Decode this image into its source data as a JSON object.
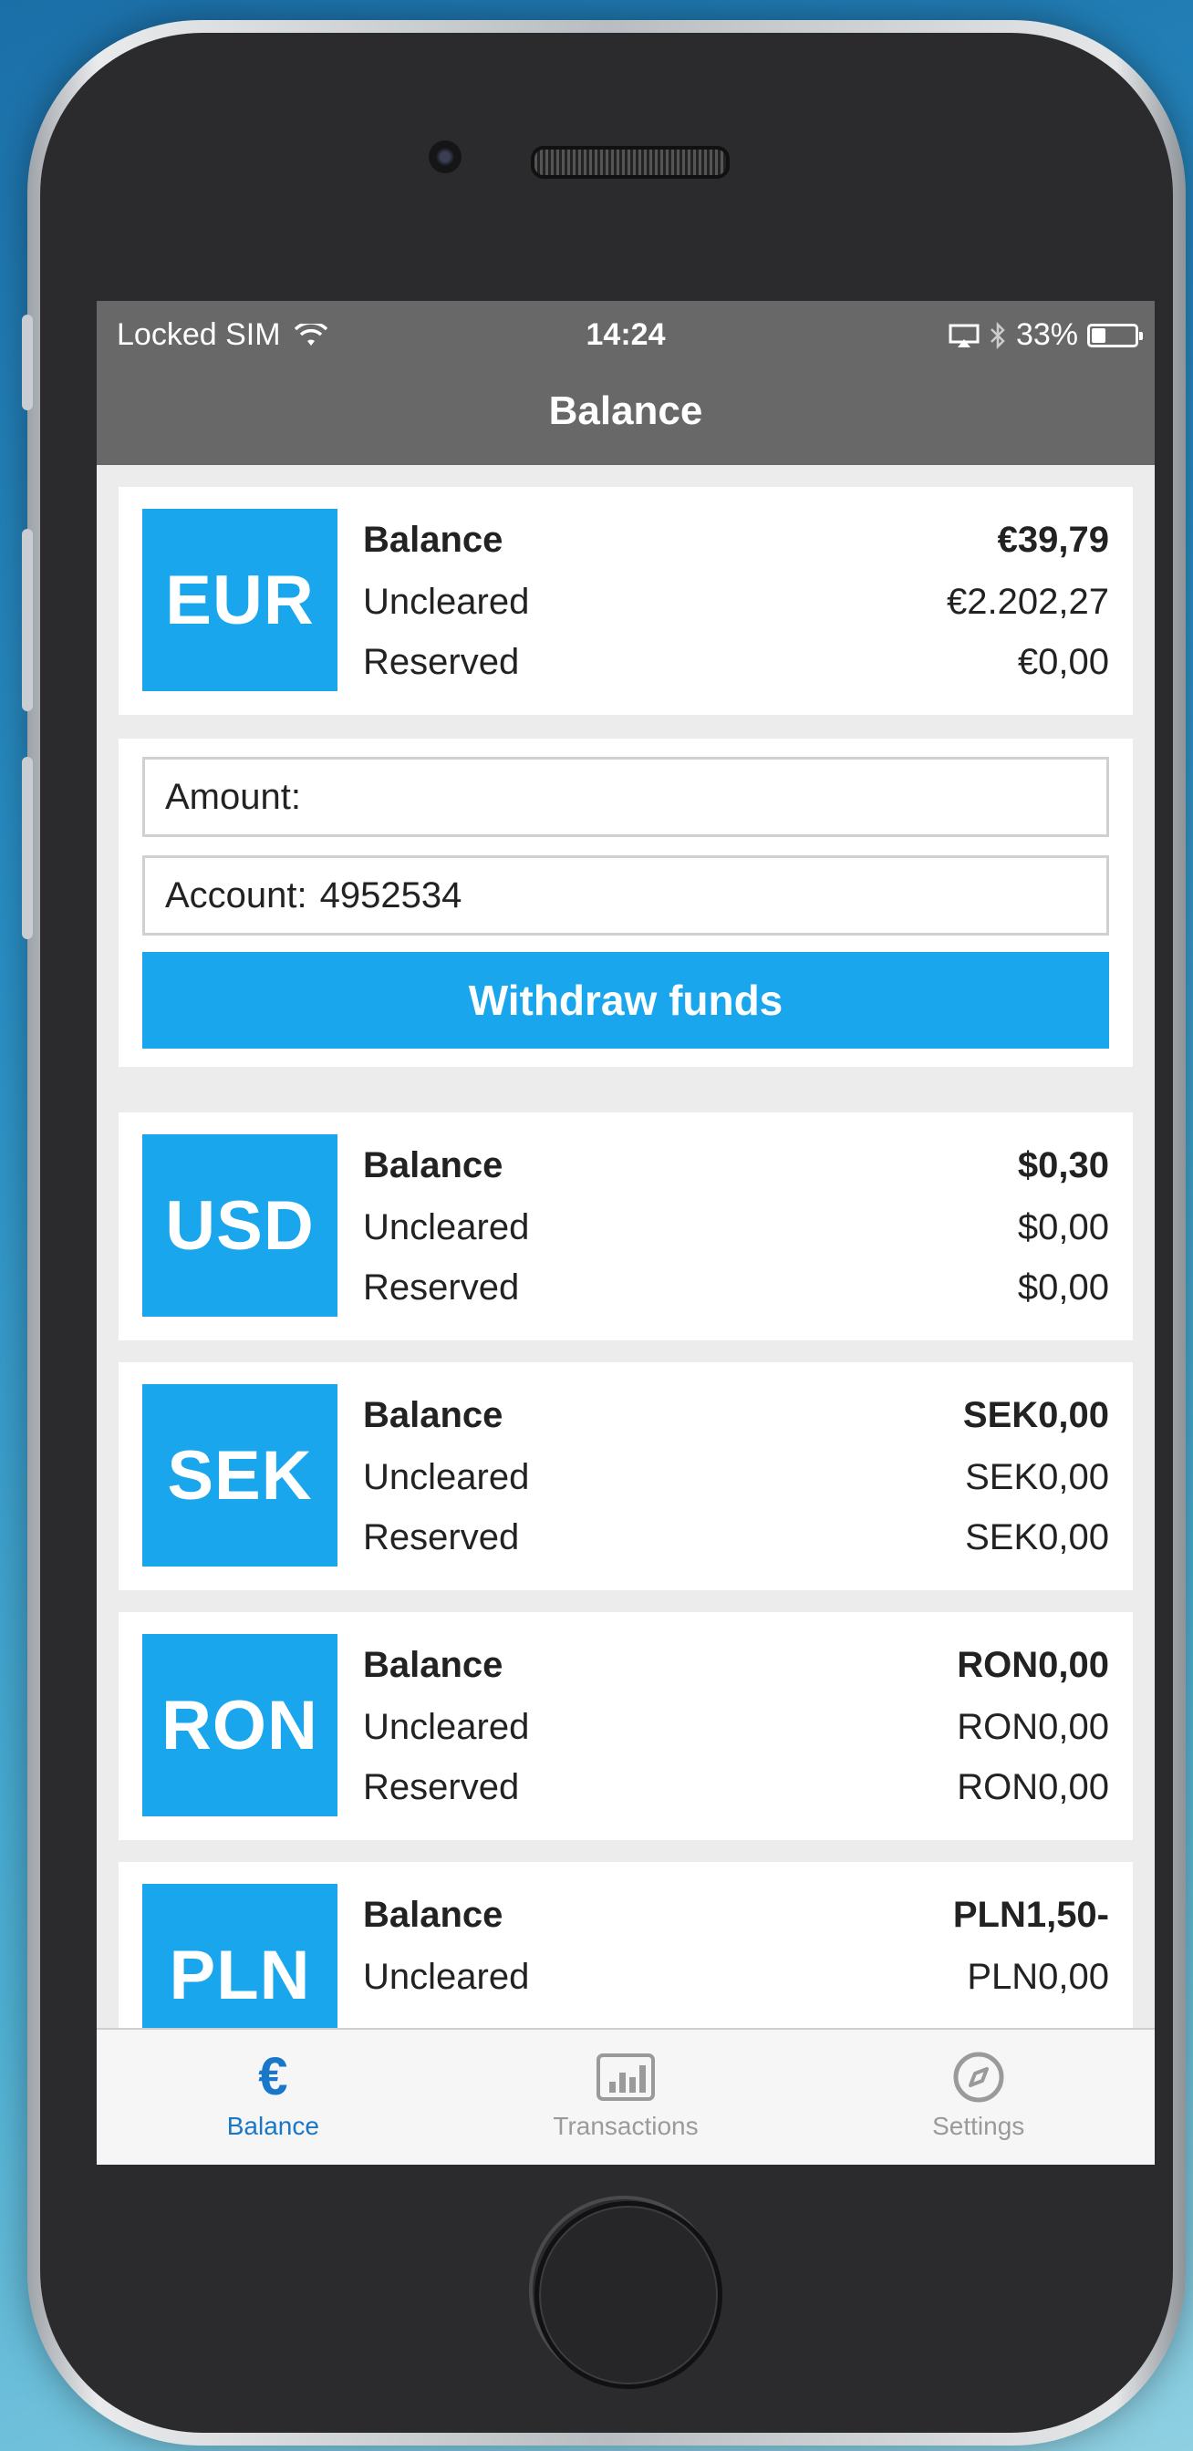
{
  "status_bar": {
    "carrier": "Locked SIM",
    "time": "14:24",
    "battery": "33%",
    "battery_level": 0.33
  },
  "nav": {
    "title": "Balance"
  },
  "accounts": [
    {
      "code": "EUR",
      "balance_label": "Balance",
      "balance": "€39,79",
      "uncleared_label": "Uncleared",
      "uncleared": "€2.202,27",
      "reserved_label": "Reserved",
      "reserved": "€0,00"
    },
    {
      "code": "USD",
      "balance_label": "Balance",
      "balance": "$0,30",
      "uncleared_label": "Uncleared",
      "uncleared": "$0,00",
      "reserved_label": "Reserved",
      "reserved": "$0,00"
    },
    {
      "code": "SEK",
      "balance_label": "Balance",
      "balance": "SEK0,00",
      "uncleared_label": "Uncleared",
      "uncleared": "SEK0,00",
      "reserved_label": "Reserved",
      "reserved": "SEK0,00"
    },
    {
      "code": "RON",
      "balance_label": "Balance",
      "balance": "RON0,00",
      "uncleared_label": "Uncleared",
      "uncleared": "RON0,00",
      "reserved_label": "Reserved",
      "reserved": "RON0,00"
    },
    {
      "code": "PLN",
      "balance_label": "Balance",
      "balance": "PLN1,50-",
      "uncleared_label": "Uncleared",
      "uncleared": "PLN0,00"
    }
  ],
  "withdraw_form": {
    "amount_label": "Amount:",
    "amount_value": "",
    "account_label": "Account:",
    "account_value": "4952534",
    "button_label": "Withdraw funds"
  },
  "tabbar": {
    "tabs": [
      {
        "label": "Balance",
        "icon": "euro-icon",
        "active": true
      },
      {
        "label": "Transactions",
        "icon": "bar-chart-icon",
        "active": false
      },
      {
        "label": "Settings",
        "icon": "compass-icon",
        "active": false
      }
    ]
  },
  "colors": {
    "accent": "#1aa6ec",
    "bar": "#686868",
    "active_tab": "#1877c9"
  }
}
